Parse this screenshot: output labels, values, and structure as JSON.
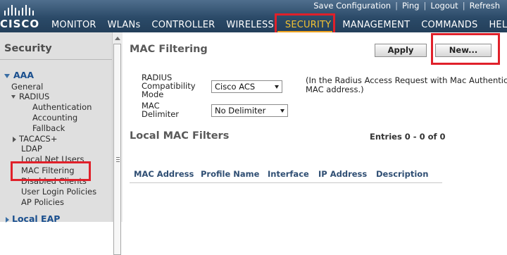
{
  "header": {
    "logo_text": "CISCO",
    "top_links": [
      "Save Configuration",
      "Ping",
      "Logout",
      "Refresh"
    ],
    "nav": [
      "MONITOR",
      "WLANs",
      "CONTROLLER",
      "WIRELESS",
      "SECURITY",
      "MANAGEMENT",
      "COMMANDS",
      "HELP"
    ],
    "active_nav": "SECURITY"
  },
  "sidebar": {
    "title": "Security",
    "aaa": "AAA",
    "general": "General",
    "radius": "RADIUS",
    "authentication": "Authentication",
    "accounting": "Accounting",
    "fallback": "Fallback",
    "tacacs": "TACACS+",
    "ldap": "LDAP",
    "local_net_users": "Local Net Users",
    "mac_filtering": "MAC Filtering",
    "disabled_clients": "Disabled Clients",
    "user_login_policies": "User Login Policies",
    "ap_policies": "AP Policies",
    "local_eap": "Local EAP"
  },
  "main": {
    "title": "MAC Filtering",
    "apply_label": "Apply",
    "new_label": "New...",
    "radius_label_1": "RADIUS",
    "radius_label_2": "Compatibility",
    "radius_label_3": "Mode",
    "radius_value": "Cisco ACS",
    "delim_label_1": "MAC",
    "delim_label_2": "Delimiter",
    "delim_value": "No Delimiter",
    "note_line1": "(In the Radius Access Request with Mac Authentic",
    "note_line2": "MAC address.)",
    "section_title": "Local MAC Filters",
    "entries": "Entries 0 - 0 of 0",
    "columns": [
      "MAC Address",
      "Profile Name",
      "Interface",
      "IP Address",
      "Description"
    ]
  },
  "colors": {
    "header_bg": "#2b4a68",
    "active_nav": "#f2c232",
    "highlight_box": "#e0202a",
    "sidebar_bg": "#dfdfdf"
  }
}
